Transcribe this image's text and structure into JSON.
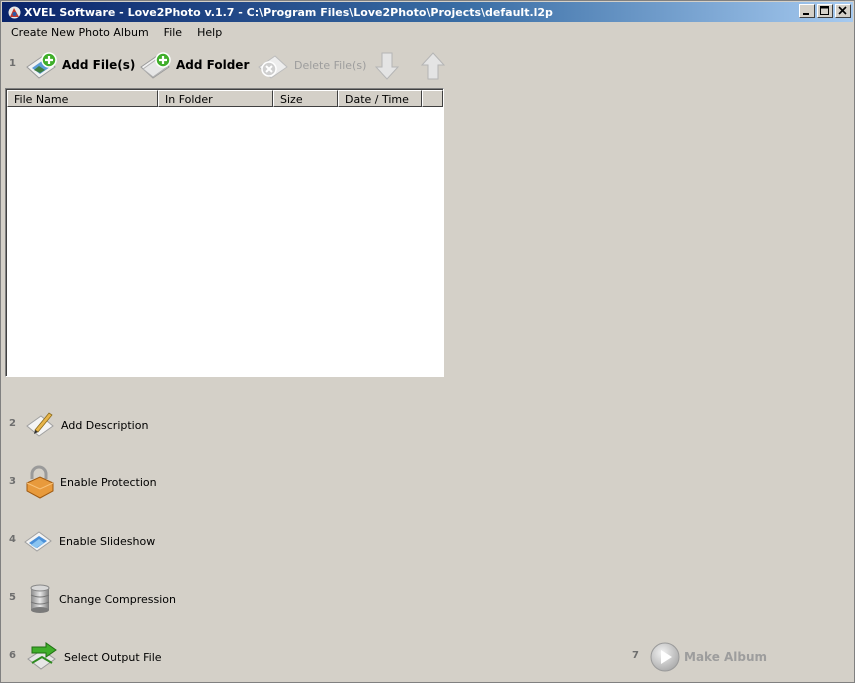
{
  "window": {
    "title": "XVEL Software - Love2Photo v.1.7 - C:\\Program Files\\Love2Photo\\Projects\\default.l2p"
  },
  "menu": [
    "Create New Photo Album",
    "File",
    "Help"
  ],
  "toolbar": {
    "step": "1",
    "add_files": "Add File(s)",
    "add_folder": "Add Folder",
    "delete_files": "Delete File(s)"
  },
  "file_list": {
    "columns": [
      "File Name",
      "In Folder",
      "Size",
      "Date / Time"
    ],
    "rows": []
  },
  "steps": [
    {
      "num": "2",
      "label": "Add Description",
      "icon": "pencil-note-icon"
    },
    {
      "num": "3",
      "label": "Enable Protection",
      "icon": "padlock-icon"
    },
    {
      "num": "4",
      "label": "Enable Slideshow",
      "icon": "slideshow-icon"
    },
    {
      "num": "5",
      "label": "Change Compression",
      "icon": "database-cylinder-icon"
    },
    {
      "num": "6",
      "label": "Select Output File",
      "icon": "output-arrow-icon"
    }
  ],
  "make_album": {
    "num": "7",
    "label": "Make Album"
  },
  "colors": {
    "titlebar_start": "#0a246a",
    "titlebar_end": "#a6caf0",
    "face": "#d4d0c8",
    "disabled": "#9d9d9d"
  }
}
